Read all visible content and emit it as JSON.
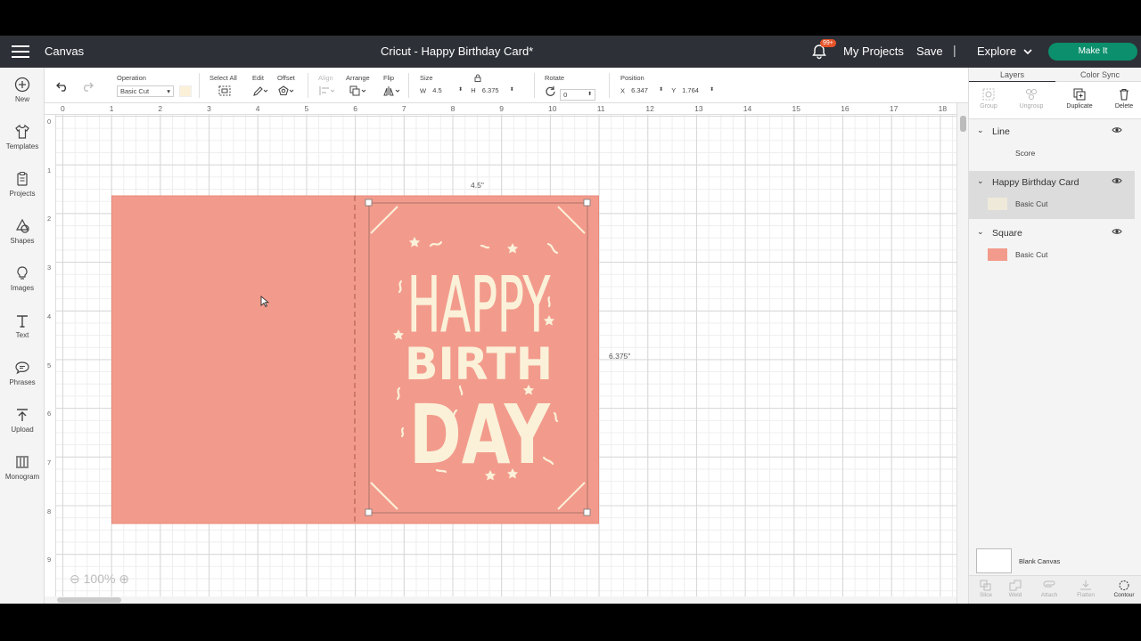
{
  "topbar": {
    "app_name": "Canvas",
    "doc_title": "Cricut - Happy Birthday Card*",
    "badge": "99+",
    "my_projects": "My Projects",
    "save": "Save",
    "separator": "|",
    "explore": "Explore",
    "make_it": "Make It"
  },
  "leftbar": {
    "items": [
      {
        "label": "New",
        "icon": "plus-circle-icon"
      },
      {
        "label": "Templates",
        "icon": "shirt-icon"
      },
      {
        "label": "Projects",
        "icon": "clipboard-icon"
      },
      {
        "label": "Shapes",
        "icon": "shapes-icon"
      },
      {
        "label": "Images",
        "icon": "lightbulb-icon"
      },
      {
        "label": "Text",
        "icon": "text-icon"
      },
      {
        "label": "Phrases",
        "icon": "speech-bubble-icon"
      },
      {
        "label": "Upload",
        "icon": "upload-icon"
      },
      {
        "label": "Monogram",
        "icon": "monogram-icon"
      }
    ]
  },
  "toolbar": {
    "operation_label": "Operation",
    "operation_value": "Basic Cut",
    "select_all": "Select All",
    "edit": "Edit",
    "offset": "Offset",
    "align": "Align",
    "arrange": "Arrange",
    "flip": "Flip",
    "size_label": "Size",
    "w_label": "W",
    "w_value": "4.5",
    "h_label": "H",
    "h_value": "6.375",
    "rotate_label": "Rotate",
    "rotate_value": "0",
    "position_label": "Position",
    "x_label": "X",
    "x_value": "6.347",
    "y_label": "Y",
    "y_value": "1.764",
    "swatch_color": "#fbf1d9"
  },
  "canvas": {
    "h_ruler": [
      "0",
      "1",
      "2",
      "3",
      "4",
      "5",
      "6",
      "7",
      "8",
      "9",
      "10",
      "11",
      "12",
      "13",
      "14",
      "15",
      "16",
      "17",
      "18"
    ],
    "v_ruler": [
      "0",
      "1",
      "2",
      "3",
      "4",
      "5",
      "6",
      "7",
      "8",
      "9"
    ],
    "width_dim": "4.5\"",
    "height_dim": "6.375\"",
    "card_color": "#f29b8c",
    "art_color": "#fbf1d9",
    "art_lines": [
      "HAPPY",
      "BIRTH",
      "DAY"
    ],
    "zoom_minus": "⊖",
    "zoom": "100%",
    "zoom_plus": "⊕"
  },
  "rightpanel": {
    "tab_layers": "Layers",
    "tab_color_sync": "Color Sync",
    "actions": [
      "Group",
      "Ungroup",
      "Duplicate",
      "Delete"
    ],
    "layers": [
      {
        "name": "Line",
        "sub": "Score",
        "swatch": ""
      },
      {
        "name": "Happy Birthday Card",
        "sub": "Basic Cut",
        "swatch": "#fbf1d9"
      },
      {
        "name": "Square",
        "sub": "Basic Cut",
        "swatch": "#f29b8c"
      }
    ],
    "blank_canvas": "Blank Canvas",
    "bottom_actions": [
      "Slice",
      "Weld",
      "Attach",
      "Flatten",
      "Contour"
    ]
  }
}
